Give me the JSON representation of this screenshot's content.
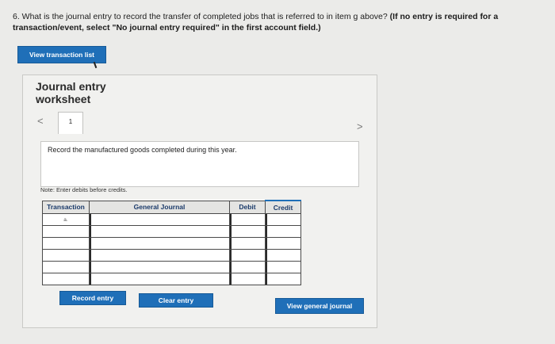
{
  "question": {
    "text": "6. What is the journal entry to record the transfer of completed jobs that is referred to in item g above? ",
    "instruction": "(If no entry is required for a transaction/event, select \"No journal entry required\" in the first account field.)"
  },
  "buttons": {
    "view_transactions": "View transaction list",
    "record_entry": "Record entry",
    "clear_entry": "Clear entry",
    "view_journal": "View general journal"
  },
  "worksheet": {
    "title_line1": "Journal entry",
    "title_line2": "worksheet",
    "prev_glyph": "<",
    "next_glyph": ">",
    "tab_number": "1",
    "description": "Record the manufactured goods completed during this year.",
    "note": "Note: Enter debits before credits."
  },
  "table": {
    "headers": {
      "transaction": "Transaction",
      "general_journal": "General Journal",
      "debit": "Debit",
      "credit": "Credit"
    },
    "rows": [
      {
        "transaction": "a.",
        "account": "",
        "debit": "",
        "credit": ""
      },
      {
        "transaction": "",
        "account": "",
        "debit": "",
        "credit": ""
      },
      {
        "transaction": "",
        "account": "",
        "debit": "",
        "credit": ""
      },
      {
        "transaction": "",
        "account": "",
        "debit": "",
        "credit": ""
      },
      {
        "transaction": "",
        "account": "",
        "debit": "",
        "credit": ""
      },
      {
        "transaction": "",
        "account": "",
        "debit": "",
        "credit": ""
      }
    ]
  },
  "colors": {
    "accent": "#1f6fb8",
    "background": "#ebebe9"
  }
}
